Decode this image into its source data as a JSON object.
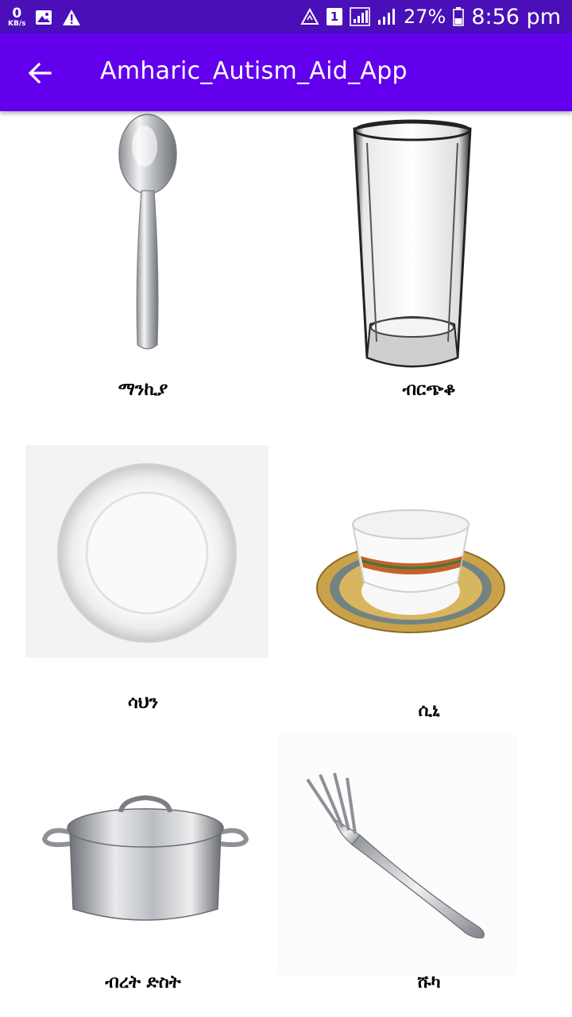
{
  "status_bar": {
    "speed_value": "0",
    "speed_unit": "KB/s",
    "sim_badge": "1",
    "battery_percent": "27%",
    "time": "8:56 pm"
  },
  "app_bar": {
    "title": "Amharic_Autism_Aid_App"
  },
  "items": [
    {
      "label": "ማንኪያ",
      "picture": "spoon"
    },
    {
      "label": "ብርጭቆ",
      "picture": "drinking-glass"
    },
    {
      "label": "ሳህን",
      "picture": "plate"
    },
    {
      "label": "ሲኒ",
      "picture": "coffee-cup"
    },
    {
      "label": "ብረት ድስት",
      "picture": "cooking-pot"
    },
    {
      "label": "ሹካ",
      "picture": "fork"
    }
  ],
  "colors": {
    "status_bar": "#4a0fb8",
    "app_bar": "#6200ee"
  }
}
